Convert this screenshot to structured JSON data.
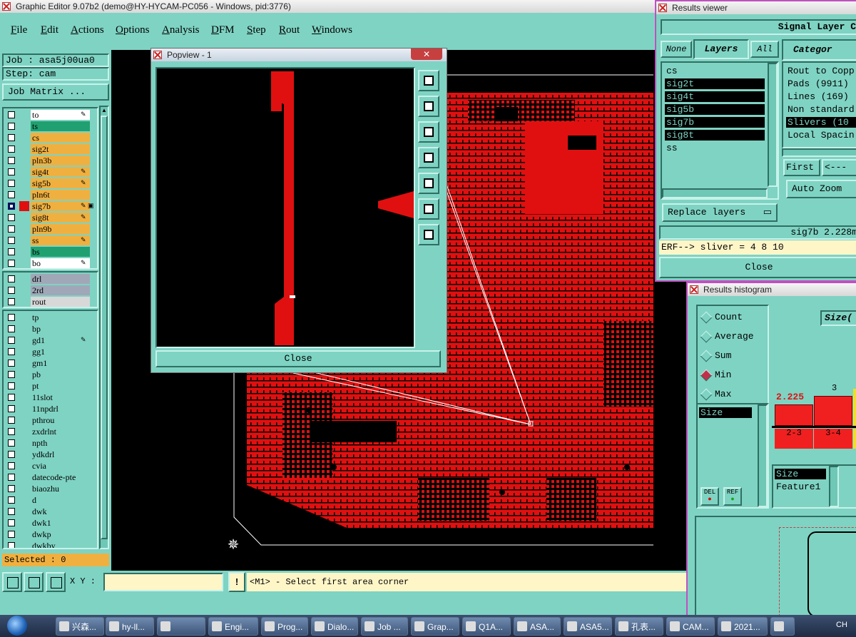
{
  "main_window": {
    "title": "Graphic Editor 9.07b2 (demo@HY-HYCAM-PC056 - Windows, pid:3776)",
    "menu": [
      "File",
      "Edit",
      "Actions",
      "Options",
      "Analysis",
      "DFM",
      "Step",
      "Rout",
      "Windows"
    ],
    "job_label": "Job : asa5j00ua0",
    "step_label": "Step: cam",
    "job_matrix_button": "Job Matrix ...",
    "selected_label": "Selected : 0",
    "xy_label": "X Y :",
    "xy_value": "",
    "status_message": "<M1> - Select first area corner"
  },
  "layers_group1": [
    {
      "name": "to",
      "color": "#ffffff",
      "edit": "✎"
    },
    {
      "name": "ts",
      "color": "#20a070",
      "edit": ""
    },
    {
      "name": "cs",
      "color": "#f0b040",
      "edit": ""
    },
    {
      "name": "sig2t",
      "color": "#f0b040",
      "edit": ""
    },
    {
      "name": "pln3b",
      "color": "#f0b040",
      "edit": ""
    },
    {
      "name": "sig4t",
      "color": "#f0b040",
      "edit": "✎"
    },
    {
      "name": "sig5b",
      "color": "#f0b040",
      "edit": "✎"
    },
    {
      "name": "pln6t",
      "color": "#f0b040",
      "edit": ""
    },
    {
      "name": "sig7b",
      "color": "#f0b040",
      "edit": "✎ ▣",
      "active": true
    },
    {
      "name": "sig8t",
      "color": "#f0b040",
      "edit": "✎"
    },
    {
      "name": "pln9b",
      "color": "#f0b040",
      "edit": ""
    },
    {
      "name": "ss",
      "color": "#f0b040",
      "edit": "✎"
    },
    {
      "name": "bs",
      "color": "#20a070",
      "edit": ""
    },
    {
      "name": "bo",
      "color": "#ffffff",
      "edit": "✎"
    }
  ],
  "layers_group2": [
    {
      "name": "drl",
      "color": "#a0a8b8"
    },
    {
      "name": "2rd",
      "color": "#a0a8b8"
    },
    {
      "name": "rout",
      "color": "#d8d8d8"
    }
  ],
  "layers_group3": [
    {
      "name": "tp",
      "edit": ""
    },
    {
      "name": "bp",
      "edit": ""
    },
    {
      "name": "gd1",
      "edit": "✎"
    },
    {
      "name": "gg1",
      "edit": ""
    },
    {
      "name": "gm1",
      "edit": ""
    },
    {
      "name": "pb",
      "edit": ""
    },
    {
      "name": "pt",
      "edit": ""
    },
    {
      "name": "11slot",
      "edit": ""
    },
    {
      "name": "11npdrl",
      "edit": ""
    },
    {
      "name": "pthrou",
      "edit": ""
    },
    {
      "name": "zxdrlnt",
      "edit": ""
    },
    {
      "name": "npth",
      "edit": ""
    },
    {
      "name": "ydkdrl",
      "edit": ""
    },
    {
      "name": "cvia",
      "edit": ""
    },
    {
      "name": "datecode-pte",
      "edit": ""
    },
    {
      "name": "biaozhu",
      "edit": ""
    },
    {
      "name": "d",
      "edit": ""
    },
    {
      "name": "dwk",
      "edit": ""
    },
    {
      "name": "dwk1",
      "edit": ""
    },
    {
      "name": "dwkp",
      "edit": ""
    },
    {
      "name": "dwkby",
      "edit": ""
    }
  ],
  "popview": {
    "title": "Popview - 1",
    "close_label": "Close",
    "tools": [
      "zoom-home-icon",
      "arrow-up-icon",
      "arrow-down-icon",
      "arrow-left-icon",
      "arrow-right-icon",
      "zoom-in-icon",
      "zoom-out-icon"
    ]
  },
  "results_viewer": {
    "title": "Results viewer",
    "header": "Signal Layer C",
    "tab_none": "None",
    "tab_layers": "Layers",
    "tab_all": "All",
    "layers": [
      {
        "name": "cs",
        "selected": false
      },
      {
        "name": "sig2t",
        "selected": true
      },
      {
        "name": "sig4t",
        "selected": true
      },
      {
        "name": "sig5b",
        "selected": true
      },
      {
        "name": "sig7b",
        "selected": true
      },
      {
        "name": "sig8t",
        "selected": true
      },
      {
        "name": "ss",
        "selected": false
      }
    ],
    "category_header": "Categor",
    "categories": [
      {
        "text": "Rout to Copp",
        "selected": false
      },
      {
        "text": "Pads (9911)",
        "selected": false
      },
      {
        "text": "Lines (169)",
        "selected": false
      },
      {
        "text": "Non standard",
        "selected": false
      },
      {
        "text": "Slivers (10",
        "selected": true
      },
      {
        "text": "Local Spacin",
        "selected": false
      }
    ],
    "first_button": "First",
    "prev_button": "<---",
    "auto_zoom_label": "Auto Zoom",
    "replace_layers_label": "Replace layers",
    "status_line": "sig7b 2.228m",
    "erf_line": "ERF--> sliver = 4 8 10",
    "close_label": "Close"
  },
  "results_histogram": {
    "title": "Results histogram",
    "radios": [
      {
        "label": "Count",
        "selected": false
      },
      {
        "label": "Average",
        "selected": false
      },
      {
        "label": "Sum",
        "selected": false
      },
      {
        "label": "Min",
        "selected": true
      },
      {
        "label": "Max",
        "selected": false
      }
    ],
    "list_item": "Size",
    "del_label": "DEL",
    "ref_label": "REF",
    "chart_header": "Size(",
    "bar_value_1": "2.225",
    "bar_value_2": "3",
    "bin_1": "2-3",
    "bin_2": "3-4",
    "fields": [
      "Size",
      "Feature1"
    ]
  },
  "taskbar": {
    "items": [
      "兴森...",
      "hy-ll...",
      "",
      "Engi...",
      "Prog...",
      "Dialo...",
      "Job ...",
      "Grap...",
      "Q1A...",
      "ASA...",
      "ASA5...",
      "孔表...",
      "CAM...",
      "2021...",
      ""
    ],
    "tray_text": "CH"
  }
}
